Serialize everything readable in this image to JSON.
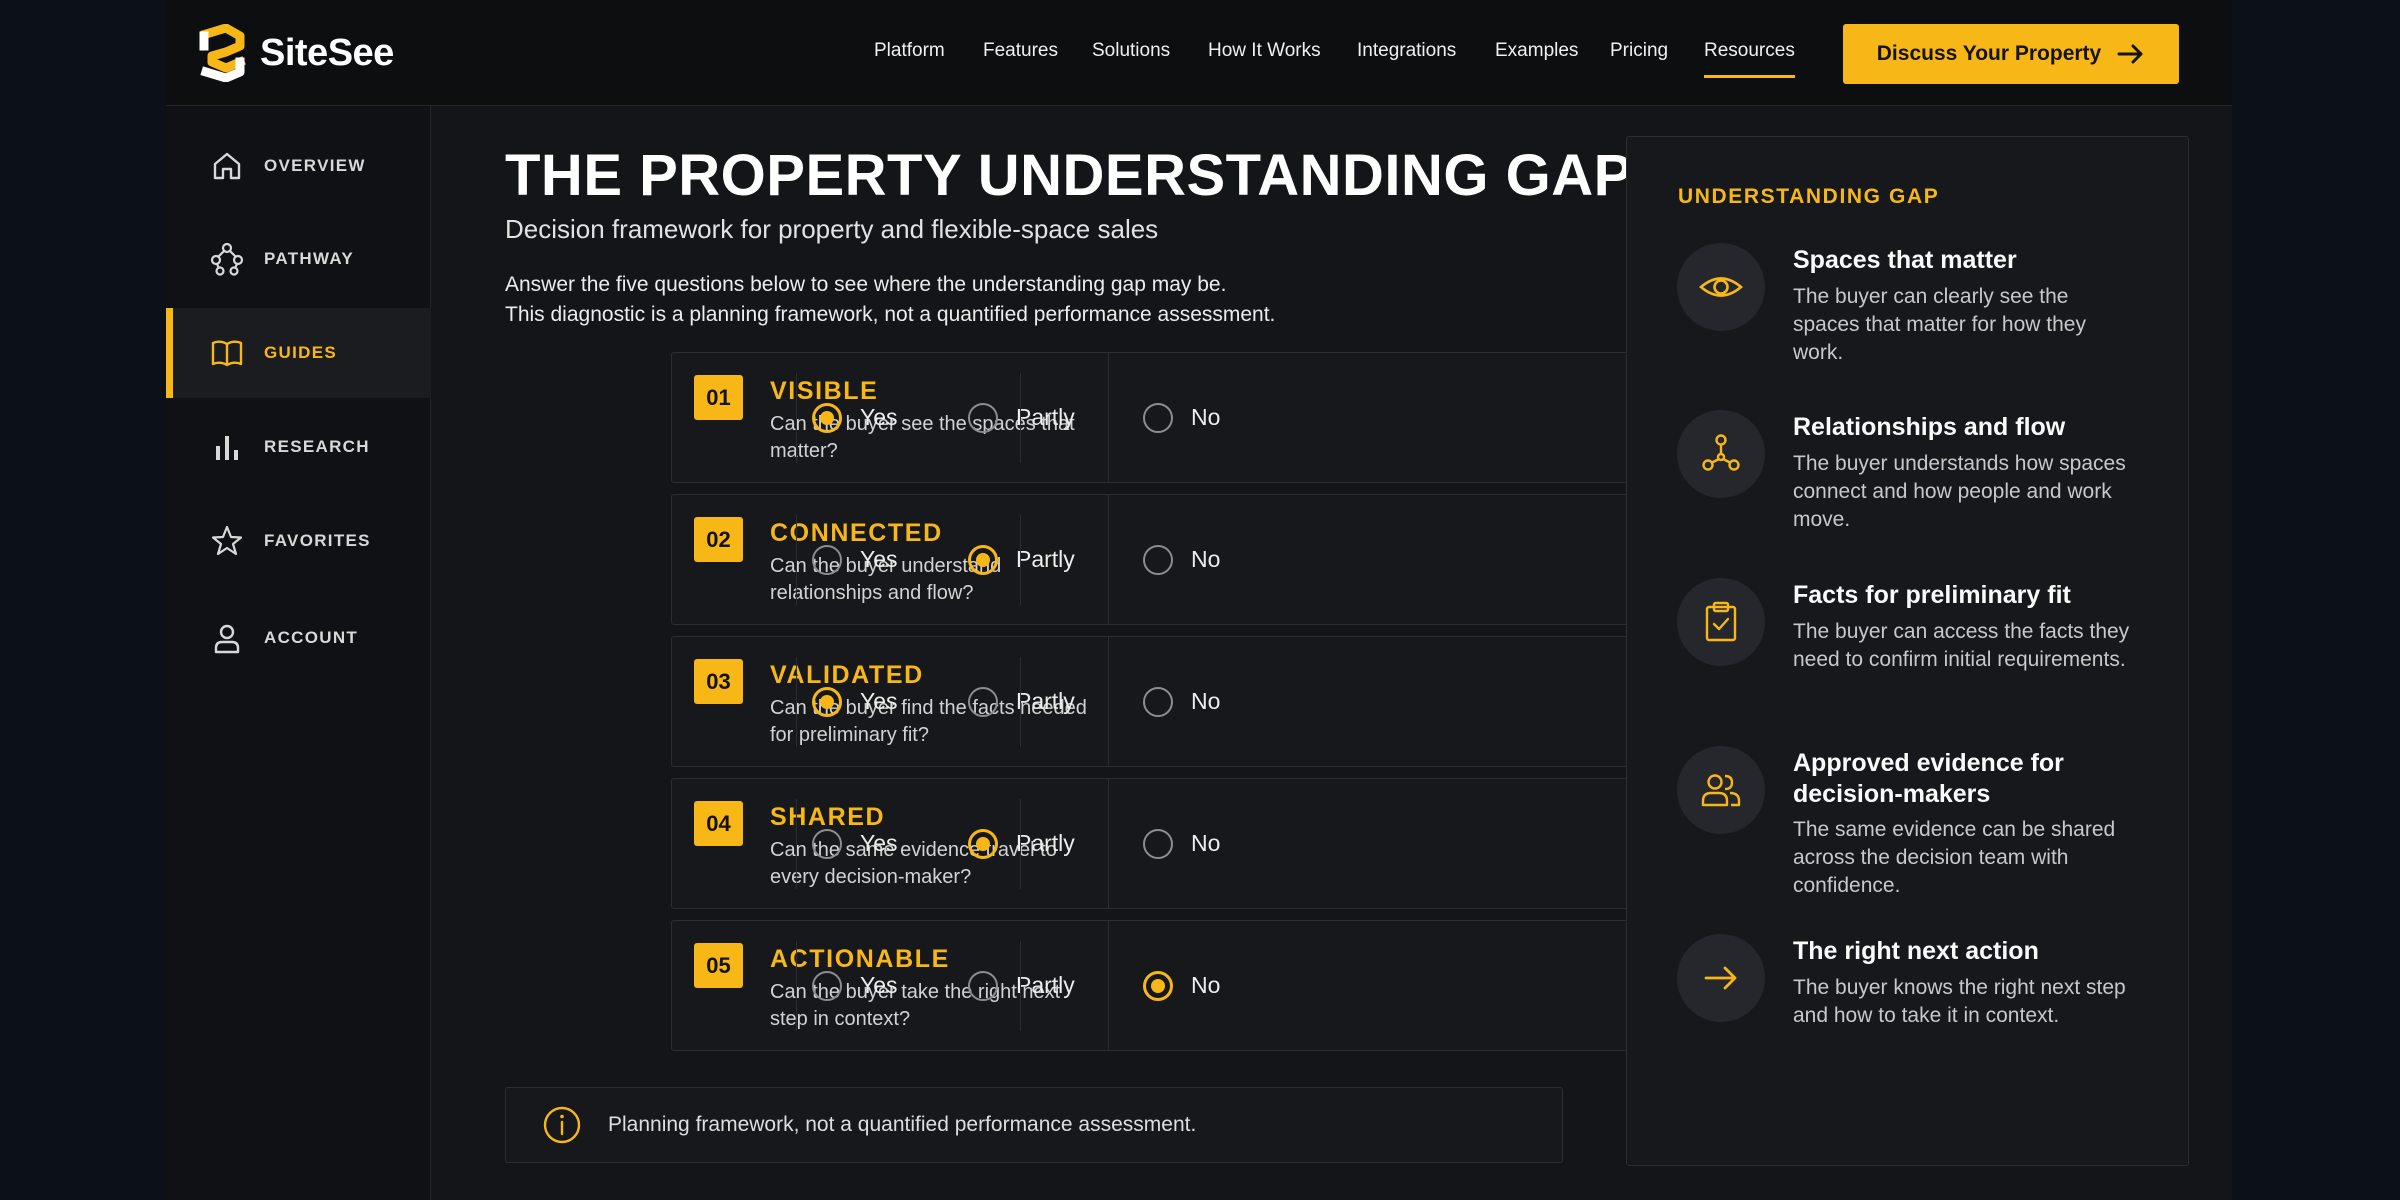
{
  "brand": {
    "name": "SiteSee",
    "accent": "#f7b817"
  },
  "nav": {
    "items": [
      "Platform",
      "Features",
      "Solutions",
      "How It Works",
      "Integrations",
      "Examples",
      "Pricing",
      "Resources"
    ],
    "active": "Resources",
    "cta_label": "Discuss Your Property"
  },
  "sidebar": {
    "items": [
      {
        "label": "OVERVIEW",
        "icon": "home-icon"
      },
      {
        "label": "PATHWAY",
        "icon": "pathway-icon"
      },
      {
        "label": "GUIDES",
        "icon": "book-icon",
        "active": true
      },
      {
        "label": "RESEARCH",
        "icon": "bar-chart-icon"
      },
      {
        "label": "FAVORITES",
        "icon": "star-icon"
      },
      {
        "label": "ACCOUNT",
        "icon": "user-icon"
      }
    ]
  },
  "main": {
    "title": "THE PROPERTY UNDERSTANDING GAP",
    "subtitle": "Decision framework for property and flexible-space sales",
    "intro_line1": "Answer the five questions below to see where the understanding gap may be.",
    "intro_line2": "This diagnostic is a planning framework, not a quantified performance assessment.",
    "options": [
      "Yes",
      "Partly",
      "No"
    ],
    "questions": [
      {
        "num": "01",
        "title": "VISIBLE",
        "desc": "Can the buyer see the spaces that matter?",
        "selected": "Yes"
      },
      {
        "num": "02",
        "title": "CONNECTED",
        "desc": "Can the buyer understand relationships and flow?",
        "selected": "Partly"
      },
      {
        "num": "03",
        "title": "VALIDATED",
        "desc": "Can the buyer find the facts needed for preliminary fit?",
        "selected": "Yes"
      },
      {
        "num": "04",
        "title": "SHARED",
        "desc": "Can the same evidence travel to every decision-maker?",
        "selected": "Partly"
      },
      {
        "num": "05",
        "title": "ACTIONABLE",
        "desc": "Can the buyer take the right next step in context?",
        "selected": "No"
      }
    ],
    "note": "Planning framework, not a quantified performance assessment."
  },
  "panel": {
    "title": "UNDERSTANDING GAP",
    "items": [
      {
        "icon": "eye-icon",
        "title": "Spaces that matter",
        "desc": "The buyer can clearly see the spaces that matter for how they work."
      },
      {
        "icon": "network-icon",
        "title": "Relationships and flow",
        "desc": "The buyer understands how spaces connect and how people and work move."
      },
      {
        "icon": "clipboard-check-icon",
        "title": "Facts for preliminary fit",
        "desc": "The buyer can access the facts they need to confirm initial requirements."
      },
      {
        "icon": "users-icon",
        "title": "Approved evidence for decision-makers",
        "desc": "The same evidence can be shared across the decision team with confidence."
      },
      {
        "icon": "arrow-right-icon",
        "title": "The right next action",
        "desc": "The buyer knows the right next step and how to take it in context."
      }
    ]
  }
}
